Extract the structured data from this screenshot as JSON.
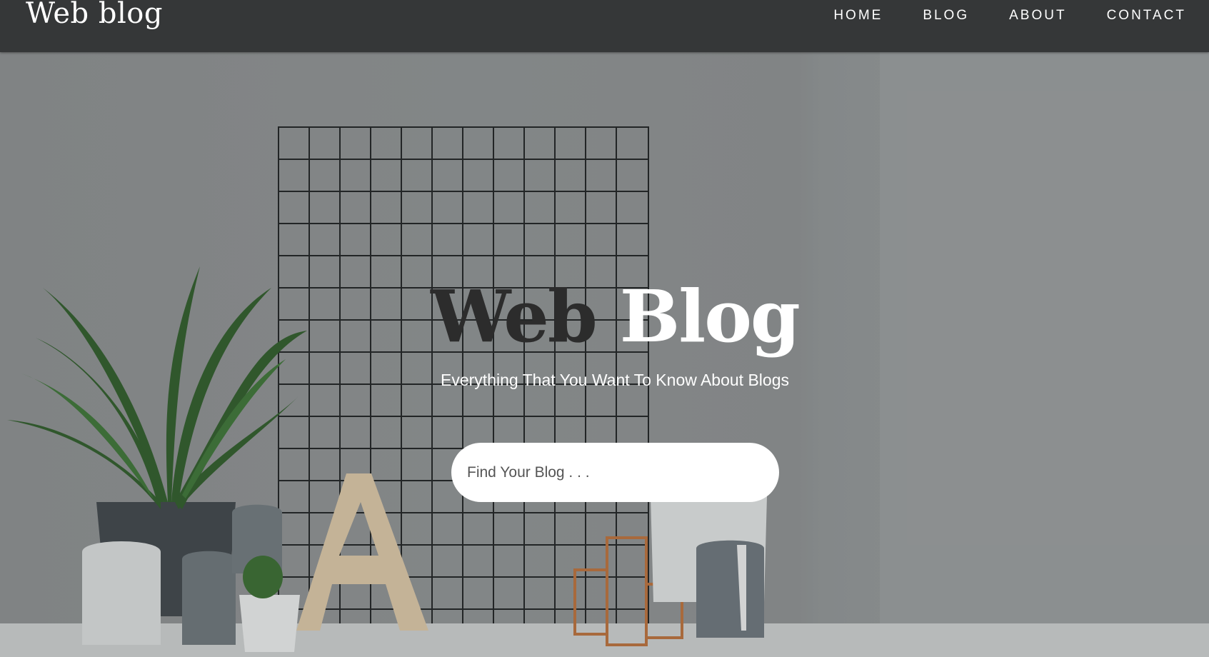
{
  "header": {
    "brand": "Web blog",
    "nav": [
      {
        "label": "HOME"
      },
      {
        "label": "BLOG"
      },
      {
        "label": "ABOUT"
      },
      {
        "label": "CONTACT"
      }
    ]
  },
  "hero": {
    "title_word_1": "Web",
    "title_word_2": "Blog",
    "subtitle": "Everything That You Want To Know About Blogs",
    "search": {
      "placeholder": "Find Your Blog . . ."
    }
  },
  "colors": {
    "navbar": "#353738",
    "hero_background": "#8b8e8f",
    "title_dark": "#2c2c2c",
    "title_light": "#ffffff"
  }
}
